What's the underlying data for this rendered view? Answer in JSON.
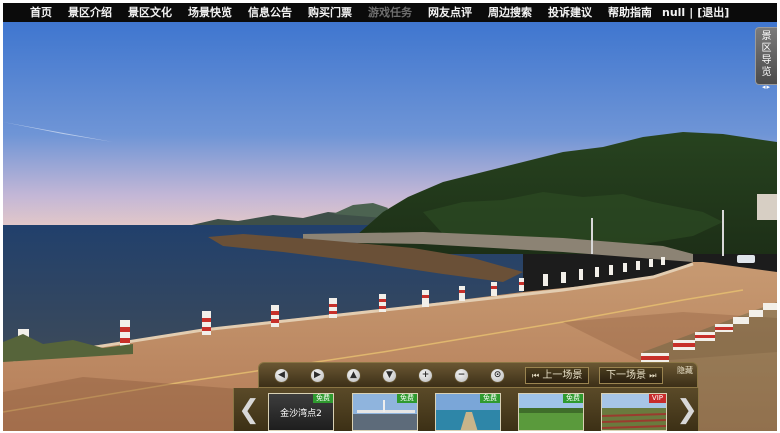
{
  "nav": {
    "items": [
      "首页",
      "景区介绍",
      "景区文化",
      "场景快览",
      "信息公告",
      "购买门票",
      "游戏任务",
      "网友点评",
      "周边搜索",
      "投诉建议",
      "帮助指南"
    ],
    "user": "null",
    "separator": "|",
    "logout": "[退出]"
  },
  "side_tab": {
    "label": "景区导览",
    "arrows": "◂▸"
  },
  "controls": {
    "buttons": [
      {
        "name": "rotate-left-icon",
        "glyph": "◀"
      },
      {
        "name": "rotate-right-icon",
        "glyph": "▶"
      },
      {
        "name": "look-up-icon",
        "glyph": "▲"
      },
      {
        "name": "look-down-icon",
        "glyph": "▼"
      },
      {
        "name": "zoom-in-icon",
        "glyph": "+"
      },
      {
        "name": "zoom-out-icon",
        "glyph": "−"
      },
      {
        "name": "fullscreen-icon",
        "glyph": "⊙"
      }
    ],
    "prev_scene": "上一场景",
    "next_scene": "下一场景",
    "prev_icon": "⏮",
    "next_icon": "⏭",
    "hide": "隐藏"
  },
  "thumbs": {
    "left_arrow": "❮",
    "right_arrow": "❯",
    "items": [
      {
        "label": "金沙湾点2",
        "badge": "免费",
        "type": "active"
      },
      {
        "label": "",
        "badge": "免费",
        "type": "free"
      },
      {
        "label": "",
        "badge": "免费",
        "type": "free"
      },
      {
        "label": "",
        "badge": "免费",
        "type": "free"
      },
      {
        "label": "",
        "badge": "VIP",
        "type": "vip"
      }
    ]
  },
  "colors": {
    "nav_bg": "#0b0b0b",
    "panel_brown": "#5a4a28",
    "free_badge": "#2f9a2f",
    "vip_badge": "#c82b2b"
  }
}
